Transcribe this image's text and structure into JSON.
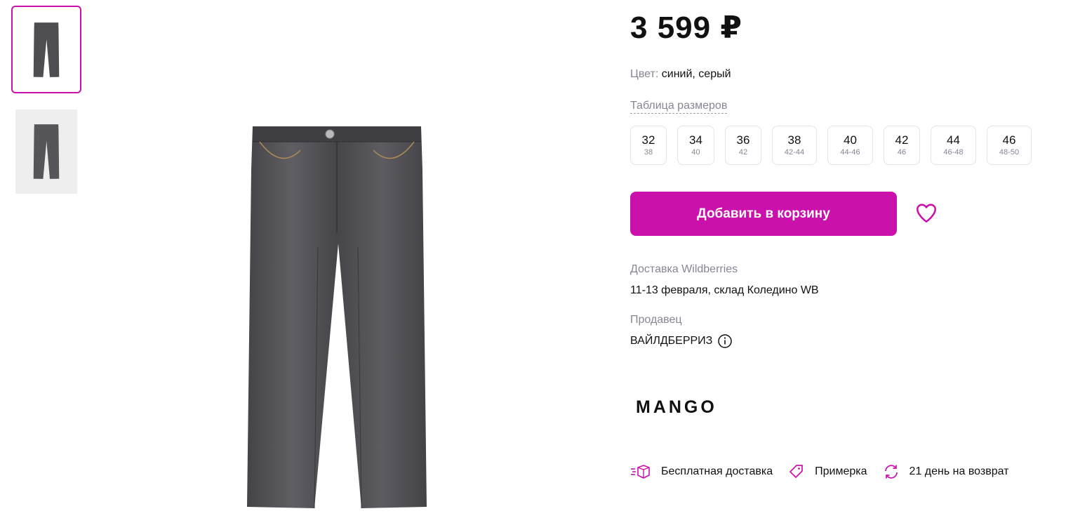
{
  "product": {
    "price": "3 599 ₽",
    "color_label": "Цвет:",
    "color_value": "синий, серый",
    "size_table_link": "Таблица размеров",
    "sizes": [
      {
        "ru": "32",
        "intl": "38"
      },
      {
        "ru": "34",
        "intl": "40"
      },
      {
        "ru": "36",
        "intl": "42"
      },
      {
        "ru": "38",
        "intl": "42-44"
      },
      {
        "ru": "40",
        "intl": "44-46"
      },
      {
        "ru": "42",
        "intl": "46"
      },
      {
        "ru": "44",
        "intl": "46-48"
      },
      {
        "ru": "46",
        "intl": "48-50"
      }
    ],
    "add_to_cart_label": "Добавить в корзину",
    "delivery_label": "Доставка Wildberries",
    "delivery_value": "11-13 февраля, склад Коледино WB",
    "seller_label": "Продавец",
    "seller_value": "ВАЙЛДБЕРРИЗ",
    "brand": "MANGO"
  },
  "perks": [
    {
      "label": "Бесплатная доставка",
      "icon": "delivery-truck-icon"
    },
    {
      "label": "Примерка",
      "icon": "price-tag-icon"
    },
    {
      "label": "21 день на возврат",
      "icon": "return-arrows-icon"
    }
  ],
  "colors": {
    "accent": "#cb11ab",
    "muted_text": "#868695",
    "denim": "#4e4e52"
  },
  "gallery": {
    "thumbnails": [
      "jeans-front-photo",
      "jeans-side-photo"
    ],
    "main": "jeans-main-photo"
  }
}
